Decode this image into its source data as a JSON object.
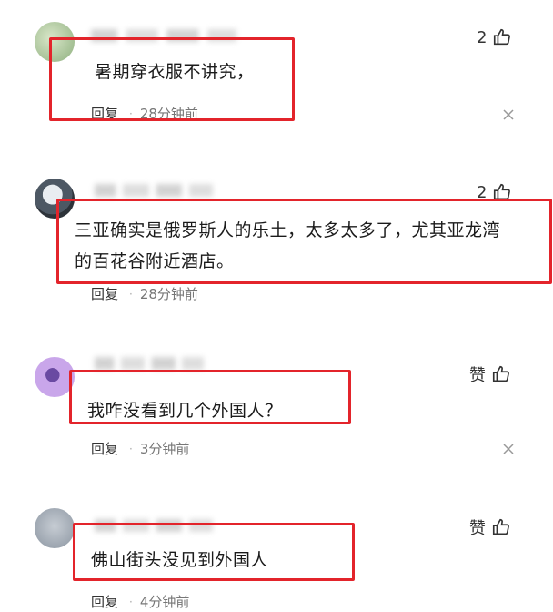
{
  "comments": [
    {
      "text_lines": [
        "暑期穿衣服不讲究，"
      ],
      "likes": "2",
      "reply": "回复",
      "time": "28分钟前",
      "avatar_color": "#a7c59a"
    },
    {
      "text_lines": [
        "三亚确实是俄罗斯人的乐土，太多太多了，尤其亚龙湾",
        "的百花谷附近酒店。"
      ],
      "likes": "2",
      "reply": "回复",
      "time": "28分钟前",
      "avatar_color": "#5b6a78"
    },
    {
      "text_lines": [
        "我咋没看到几个外国人？"
      ],
      "likes": "赞",
      "reply": "回复",
      "time": "3分钟前",
      "avatar_color": "#b58bd8"
    },
    {
      "text_lines": [
        "佛山街头没见到外国人"
      ],
      "likes": "赞",
      "reply": "回复",
      "time": "4分钟前",
      "avatar_color": "#9aa4b0"
    }
  ],
  "accent_color": "#e3242b"
}
